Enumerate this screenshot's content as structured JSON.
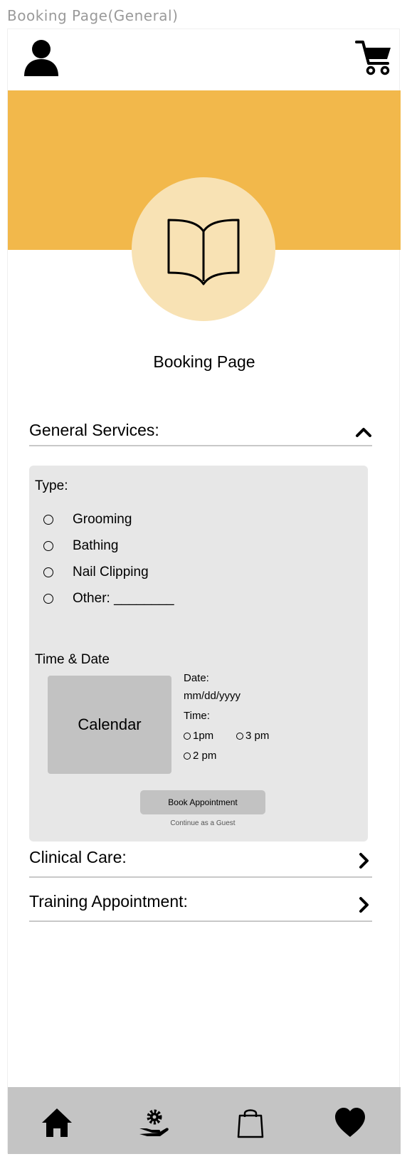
{
  "frame_title": "Booking Page(General)",
  "header": {
    "profile_icon": "user-icon",
    "cart_icon": "cart-icon"
  },
  "hero": {
    "icon": "open-book-icon",
    "colors": {
      "banner": "#f2b84b",
      "circle": "#f8e2b4"
    }
  },
  "page_title": "Booking Page",
  "general_services": {
    "title": "General Services:",
    "expanded": true,
    "type_label": "Type:",
    "options": [
      {
        "label": "Grooming"
      },
      {
        "label": "Bathing"
      },
      {
        "label": "Nail Clipping"
      },
      {
        "label": "Other: ________"
      }
    ],
    "time_date_label": "Time & Date",
    "calendar_label": "Calendar",
    "date_label": "Date:",
    "date_value": "mm/dd/yyyy",
    "time_label": "Time:",
    "time_options": [
      {
        "label": "1pm"
      },
      {
        "label": "3 pm"
      },
      {
        "label": "2 pm"
      }
    ],
    "book_button": "Book Appointment",
    "guest_link": "Continue as a Guest"
  },
  "clinical_care": {
    "title": "Clinical Care:",
    "expanded": false
  },
  "training_appointment": {
    "title": "Training Appointment:",
    "expanded": false
  },
  "bottom_nav": {
    "items": [
      {
        "icon": "home-icon"
      },
      {
        "icon": "hand-gear-icon"
      },
      {
        "icon": "shopping-bag-icon"
      },
      {
        "icon": "heart-icon"
      }
    ]
  }
}
